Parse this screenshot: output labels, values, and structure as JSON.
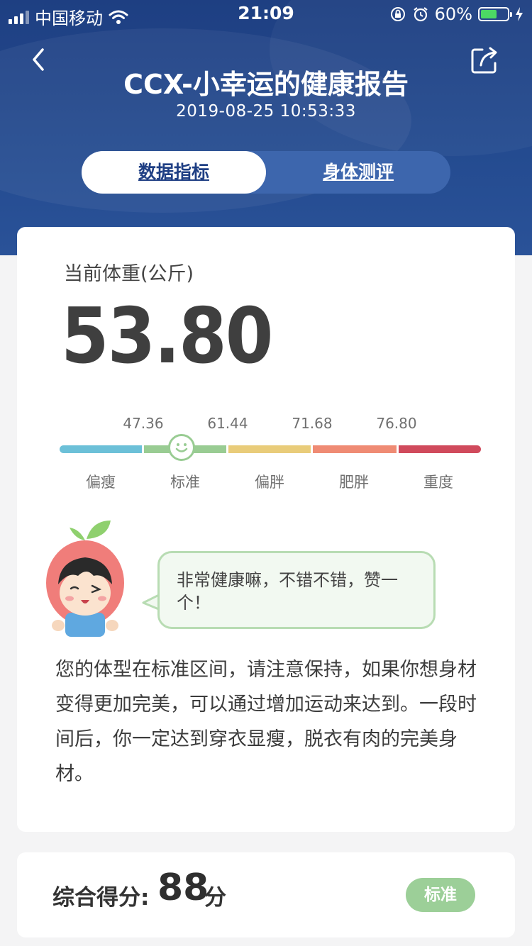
{
  "status_bar": {
    "carrier": "中国移动",
    "time": "21:09",
    "battery_percent": "60%",
    "battery_level": 0.6,
    "icons": [
      "signal-icon",
      "wifi-icon",
      "lock-rotation-icon",
      "alarm-icon",
      "battery-icon",
      "charging-icon"
    ]
  },
  "header": {
    "title": "CCX-小幸运的健康报告",
    "datetime": "2019-08-25 10:53:33",
    "back_icon": "chevron-left-icon",
    "share_icon": "share-icon"
  },
  "tabs": [
    {
      "label": "数据指标",
      "active": true
    },
    {
      "label": "身体测评",
      "active": false
    }
  ],
  "weight": {
    "label": "当前体重(公斤)",
    "value": "53.80"
  },
  "scale": {
    "thresholds": [
      "47.36",
      "61.44",
      "71.68",
      "76.80"
    ],
    "categories": [
      "偏瘦",
      "标准",
      "偏胖",
      "肥胖",
      "重度"
    ],
    "colors": [
      "#6cc0d8",
      "#99cc93",
      "#e9cc7a",
      "#ef8b74",
      "#d04a5c"
    ],
    "current_category": "标准"
  },
  "advice": {
    "bubble": "非常健康嘛，不错不错，赞一个！",
    "description": "您的体型在标准区间，请注意保持，如果你想身材变得更加完美，可以通过增加运动来达到。一段时间后，你一定达到穿衣显瘦，脱衣有肉的完美身材。"
  },
  "score": {
    "label": "综合得分:",
    "value": "88",
    "unit": "分",
    "badge": "标准"
  }
}
